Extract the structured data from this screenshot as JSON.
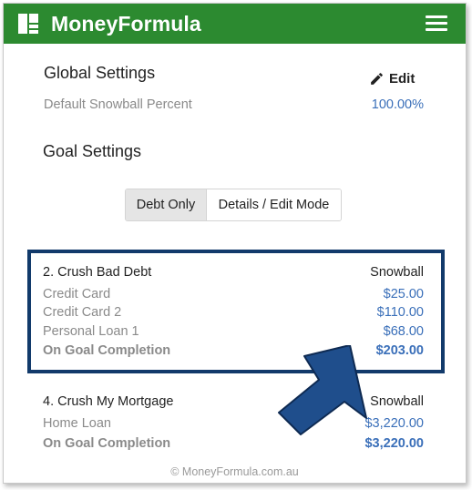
{
  "header": {
    "brand": "MoneyFormula",
    "logo_icon": "grid-logo-icon",
    "menu_icon": "hamburger-menu-icon",
    "bar_color": "#2c8a30"
  },
  "global_settings": {
    "title": "Global Settings",
    "edit_label": "Edit",
    "edit_icon": "pencil-icon",
    "label": "Default Snowball Percent",
    "value": "100.00%"
  },
  "goal_settings": {
    "title": "Goal Settings",
    "toggle": {
      "options": [
        "Debt Only",
        "Details / Edit Mode"
      ],
      "selected": "Debt Only"
    }
  },
  "goals": [
    {
      "name": "2. Crush Bad Debt",
      "strategy": "Snowball",
      "items": [
        {
          "label": "Credit Card",
          "amount": "$25.00"
        },
        {
          "label": "Credit Card 2",
          "amount": "$110.00"
        },
        {
          "label": "Personal Loan 1",
          "amount": "$68.00"
        }
      ],
      "completion_label": "On Goal Completion",
      "completion_amount": "$203.00"
    },
    {
      "name": "4. Crush My Mortgage",
      "strategy": "Snowball",
      "items": [
        {
          "label": "Home Loan",
          "amount": "$3,220.00"
        }
      ],
      "completion_label": "On Goal Completion",
      "completion_amount": "$3,220.00"
    }
  ],
  "footer": "© MoneyFormula.com.au",
  "colors": {
    "highlight_border": "#123a6b",
    "arrow_fill": "#1f4e8c",
    "amount_blue": "#3a6fb9"
  }
}
